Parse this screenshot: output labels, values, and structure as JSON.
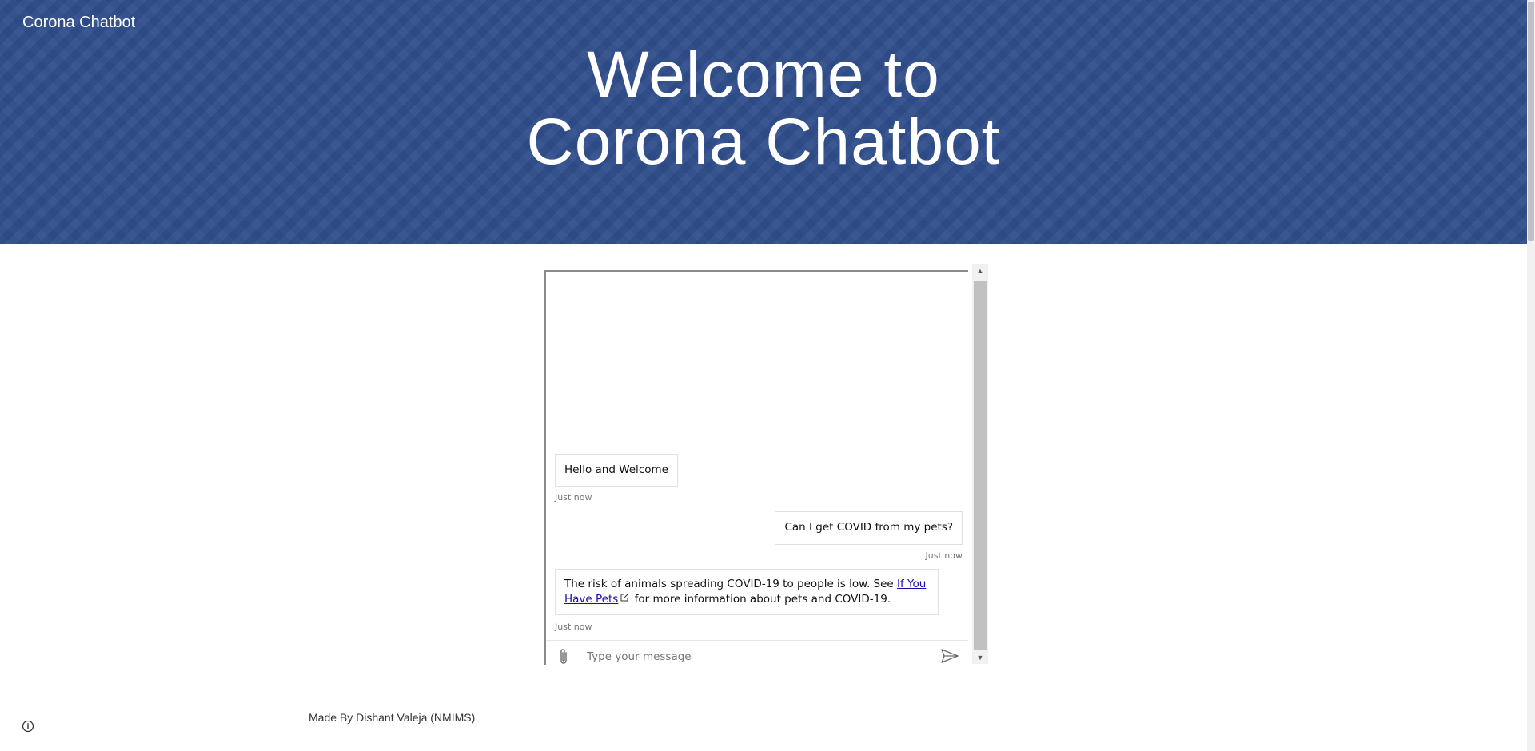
{
  "header": {
    "brand": "Corona Chatbot",
    "title_line1": "Welcome to",
    "title_line2": "Corona Chatbot"
  },
  "chat": {
    "messages": [
      {
        "from": "bot",
        "text": "Hello and Welcome",
        "time": "Just now"
      },
      {
        "from": "user",
        "text": "Can I get COVID from my pets?",
        "time": "Just now"
      },
      {
        "from": "bot",
        "text_before": "The risk of animals spreading COVID-19 to people is low. See ",
        "link_text": "If You Have Pets",
        "text_after": " for more information about pets and COVID-19.",
        "time": "Just now"
      }
    ],
    "input_placeholder": "Type your message"
  },
  "footer": {
    "credit": "Made By Dishant Valeja (NMIMS)"
  },
  "icons": {
    "attach": "paperclip-icon",
    "send": "send-icon",
    "external_link": "external-link-icon",
    "info": "info-icon"
  },
  "colors": {
    "header_background": "#2f4e8c",
    "link": "#1a0dab"
  }
}
